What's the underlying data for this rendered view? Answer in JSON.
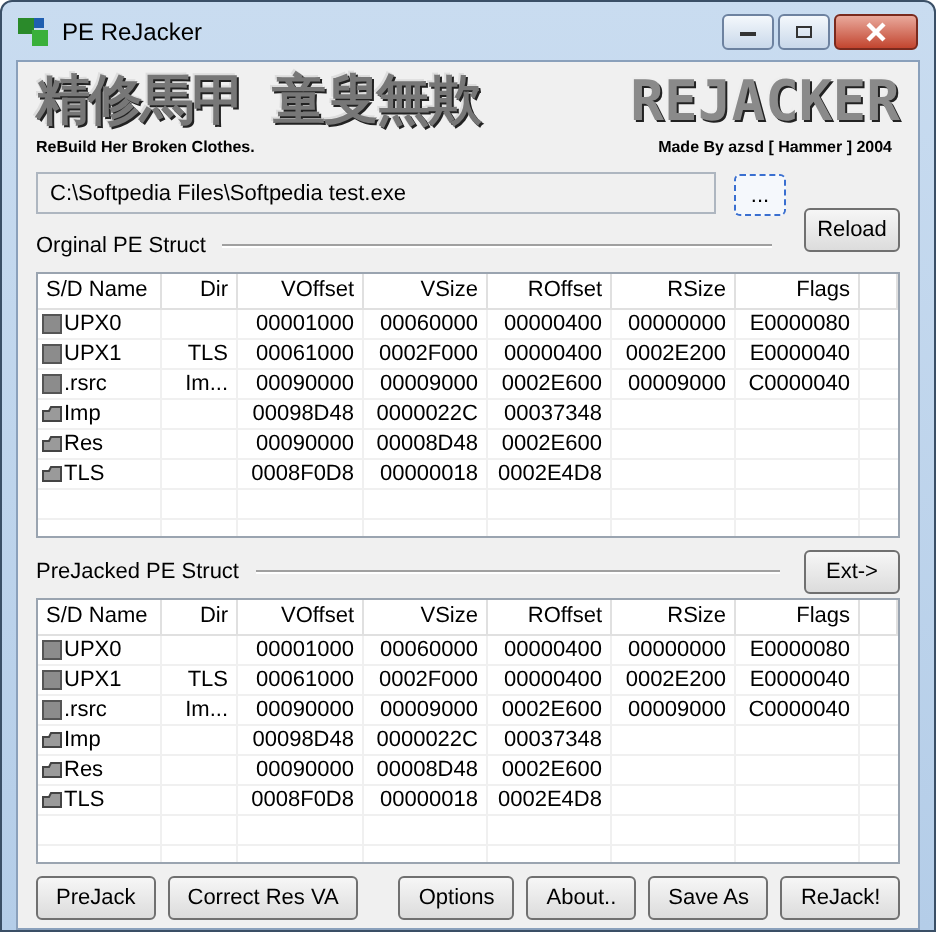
{
  "window": {
    "title": "PE ReJacker"
  },
  "banner": {
    "chinese_1": "精修馬甲",
    "chinese_2": "童叟無欺",
    "logo": "REJACKER",
    "tagline": "ReBuild Her Broken Clothes.",
    "credit": "Made By azsd [ Hammer ] 2004"
  },
  "file_path": {
    "value": "C:\\Softpedia Files\\Softpedia test.exe"
  },
  "browse_button": "...",
  "reload_button": "Reload",
  "original": {
    "title": "Orginal PE Struct",
    "columns": [
      "S/D Name",
      "Dir",
      "VOffset",
      "VSize",
      "ROffset",
      "RSize",
      "Flags"
    ],
    "rows": [
      {
        "kind": "section",
        "cells": [
          "UPX0",
          "",
          "00001000",
          "00060000",
          "00000400",
          "00000000",
          "E0000080"
        ]
      },
      {
        "kind": "section",
        "cells": [
          "UPX1",
          "TLS",
          "00061000",
          "0002F000",
          "00000400",
          "0002E200",
          "E0000040"
        ]
      },
      {
        "kind": "section",
        "cells": [
          ".rsrc",
          "Im...",
          "00090000",
          "00009000",
          "0002E600",
          "00009000",
          "C0000040"
        ]
      },
      {
        "kind": "directory",
        "cells": [
          "Imp",
          "",
          "00098D48",
          "0000022C",
          "00037348",
          "",
          ""
        ]
      },
      {
        "kind": "directory",
        "cells": [
          "Res",
          "",
          "00090000",
          "00008D48",
          "0002E600",
          "",
          ""
        ]
      },
      {
        "kind": "directory",
        "cells": [
          "TLS",
          "",
          "0008F0D8",
          "00000018",
          "0002E4D8",
          "",
          ""
        ]
      }
    ]
  },
  "ext_button": "Ext->",
  "prejacked": {
    "title": "PreJacked PE Struct",
    "columns": [
      "S/D Name",
      "Dir",
      "VOffset",
      "VSize",
      "ROffset",
      "RSize",
      "Flags"
    ],
    "rows": [
      {
        "kind": "section",
        "cells": [
          "UPX0",
          "",
          "00001000",
          "00060000",
          "00000400",
          "00000000",
          "E0000080"
        ]
      },
      {
        "kind": "section",
        "cells": [
          "UPX1",
          "TLS",
          "00061000",
          "0002F000",
          "00000400",
          "0002E200",
          "E0000040"
        ]
      },
      {
        "kind": "section",
        "cells": [
          ".rsrc",
          "Im...",
          "00090000",
          "00009000",
          "0002E600",
          "00009000",
          "C0000040"
        ]
      },
      {
        "kind": "directory",
        "cells": [
          "Imp",
          "",
          "00098D48",
          "0000022C",
          "00037348",
          "",
          ""
        ]
      },
      {
        "kind": "directory",
        "cells": [
          "Res",
          "",
          "00090000",
          "00008D48",
          "0002E600",
          "",
          ""
        ]
      },
      {
        "kind": "directory",
        "cells": [
          "TLS",
          "",
          "0008F0D8",
          "00000018",
          "0002E4D8",
          "",
          ""
        ]
      }
    ]
  },
  "buttons": [
    "PreJack",
    "Correct Res VA",
    "Options",
    "About..",
    "Save As",
    "ReJack!"
  ]
}
